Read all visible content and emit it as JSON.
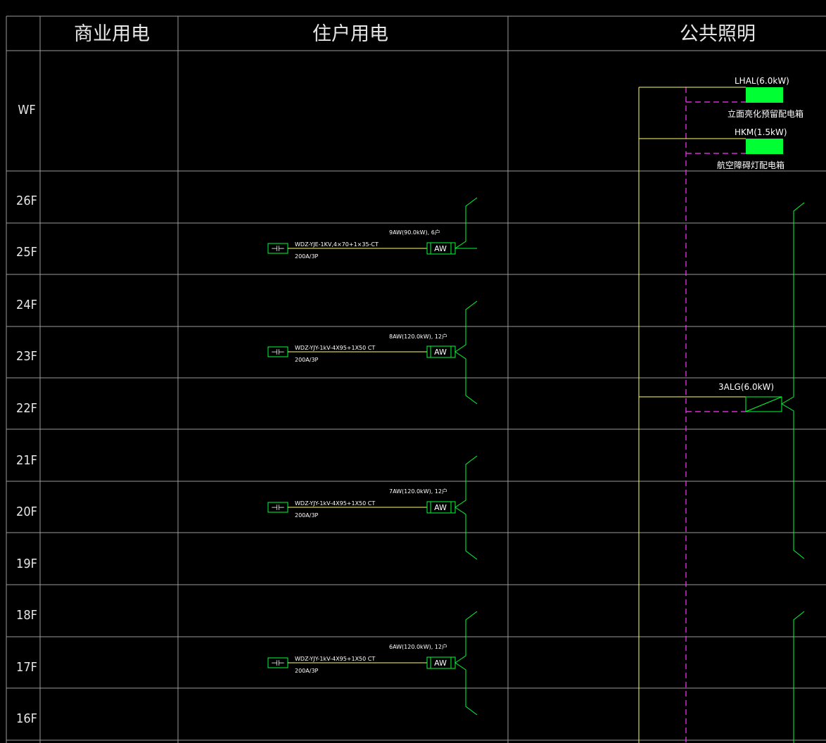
{
  "headers": {
    "commercial": "商业用电",
    "residential": "住户用电",
    "public_lighting": "公共照明"
  },
  "floors": [
    "WF",
    "26F",
    "25F",
    "24F",
    "23F",
    "22F",
    "21F",
    "20F",
    "19F",
    "18F",
    "17F",
    "16F"
  ],
  "feeders": [
    {
      "floor": "25F",
      "panel": "AW",
      "load": "9AW(90.0kW), 6户",
      "cable": "WDZ-YJE-1KV,4×70+1×35-CT",
      "breaker": "200A/3P",
      "switch_symbol": "⊣⊢"
    },
    {
      "floor": "23F",
      "panel": "AW",
      "load": "8AW(120.0kW), 12户",
      "cable": "WDZ-YJY-1kV-4X95+1X50 CT",
      "breaker": "200A/3P",
      "switch_symbol": "⊣⊢"
    },
    {
      "floor": "20F",
      "panel": "AW",
      "load": "7AW(120.0kW), 12户",
      "cable": "WDZ-YJY-1kV-4X95+1X50 CT",
      "breaker": "200A/3P",
      "switch_symbol": "⊣⊢"
    },
    {
      "floor": "17F",
      "panel": "AW",
      "load": "6AW(120.0kW), 12户",
      "cable": "WDZ-YJY-1kV-4X95+1X50 CT",
      "breaker": "200A/3P",
      "switch_symbol": "⊣⊢"
    }
  ],
  "lighting_panels": [
    {
      "id": "LHAL",
      "title": "LHAL(6.0kW)",
      "caption": "立面亮化预留配电箱",
      "floor": "WF"
    },
    {
      "id": "HKM",
      "title": "HKM(1.5kW)",
      "caption": "航空障碍灯配电箱",
      "floor": "WF"
    },
    {
      "id": "3ALG",
      "title": "3ALG(6.0kW)",
      "caption": "",
      "floor": "22F"
    }
  ],
  "colors": {
    "background": "#000000",
    "grid": "#9a9a9a",
    "text": "#e6e6e6",
    "feeder": "#00ff33",
    "trunk": "#ffff66",
    "dashed": "#ff33ff",
    "panel_fill": "#00ff33"
  }
}
